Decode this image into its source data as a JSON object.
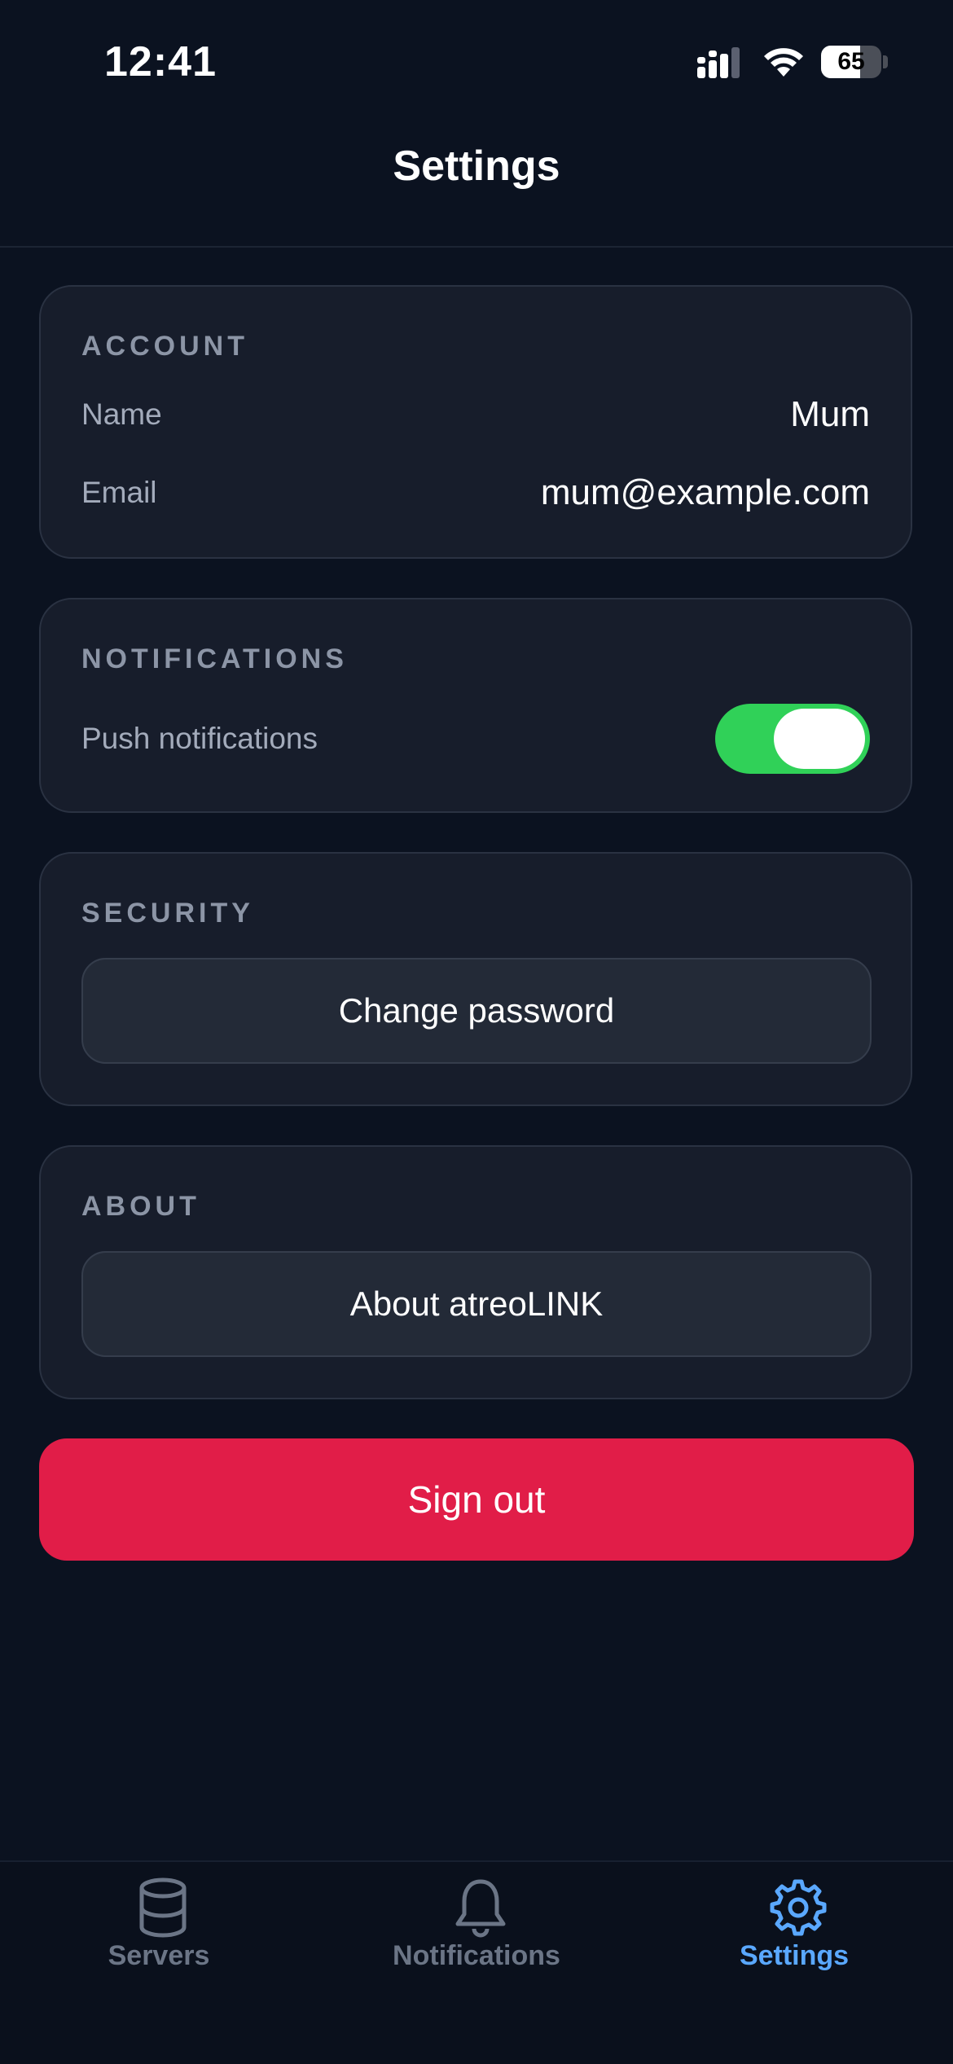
{
  "status_bar": {
    "time": "12:41",
    "battery": "65",
    "battery_level": 0.65
  },
  "header": {
    "title": "Settings"
  },
  "account": {
    "title": "ACCOUNT",
    "name_label": "Name",
    "name_value": "Mum",
    "email_label": "Email",
    "email_value": "mum@example.com"
  },
  "notifications": {
    "title": "NOTIFICATIONS",
    "push_label": "Push notifications",
    "push_enabled": true
  },
  "security": {
    "title": "SECURITY",
    "change_password_label": "Change password"
  },
  "about": {
    "title": "ABOUT",
    "about_label": "About atreoLINK"
  },
  "sign_out_label": "Sign out",
  "tabs": [
    {
      "label": "Servers",
      "icon": "database-icon",
      "active": false
    },
    {
      "label": "Notifications",
      "icon": "bell-icon",
      "active": false
    },
    {
      "label": "Settings",
      "icon": "gear-icon",
      "active": true
    }
  ],
  "colors": {
    "background": "#0b1220",
    "card": "#171d2b",
    "toggle_on": "#30d158",
    "danger": "#e11d48",
    "accent": "#5aa8ff"
  }
}
